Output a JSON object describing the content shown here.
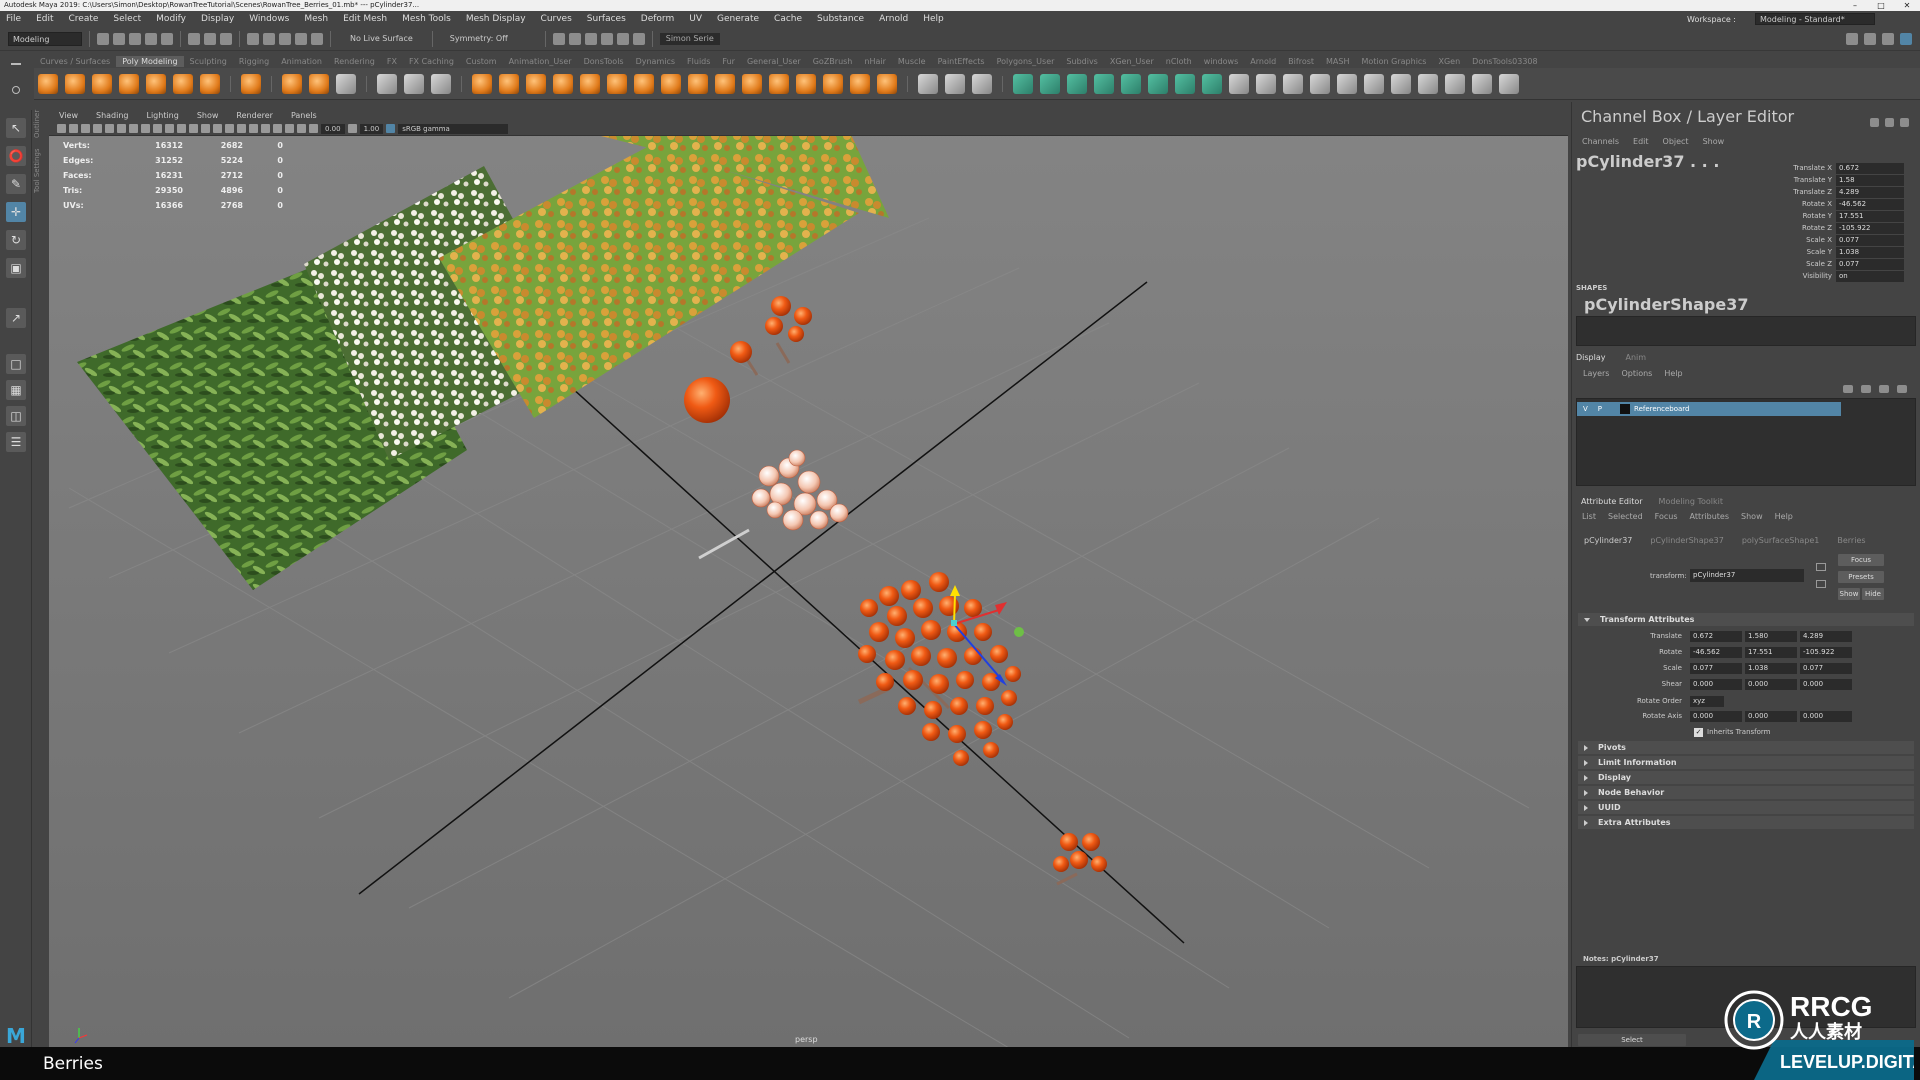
{
  "window": {
    "title": "Autodesk Maya 2019: C:\\Users\\Simon\\Desktop\\RowanTreeTutorial\\Scenes\\RowanTree_Berries_01.mb* --- pCylinder37...",
    "controls": [
      "–",
      "□",
      "✕"
    ]
  },
  "menu": [
    "File",
    "Edit",
    "Create",
    "Select",
    "Modify",
    "Display",
    "Windows",
    "Mesh",
    "Edit Mesh",
    "Mesh Tools",
    "Mesh Display",
    "Curves",
    "Surfaces",
    "Deform",
    "UV",
    "Generate",
    "Cache",
    "Substance",
    "Arnold",
    "Help"
  ],
  "workspace": {
    "label": "Workspace :",
    "value": "Modeling - Standard*"
  },
  "statusline": {
    "mode": "Modeling",
    "live": "No Live Surface",
    "symmetry": "Symmetry: Off",
    "user": "Simon Serie"
  },
  "shelf_tabs": [
    "Curves / Surfaces",
    "Poly Modeling",
    "Sculpting",
    "Rigging",
    "Animation",
    "Rendering",
    "FX",
    "FX Caching",
    "Custom",
    "Animation_User",
    "DonsTools",
    "Dynamics",
    "Fluids",
    "Fur",
    "General_User",
    "GoZBrush",
    "nHair",
    "Muscle",
    "PaintEffects",
    "Polygons_User",
    "Subdivs",
    "XGen_User",
    "nCloth",
    "windows",
    "Arnold",
    "Bifrost",
    "MASH",
    "Motion Graphics",
    "XGen",
    "DonsTools03308"
  ],
  "shelf_active": "Poly Modeling",
  "toolbox_tabs": [
    "Tool Settings",
    "Outliner"
  ],
  "viewport": {
    "menu": [
      "View",
      "Shading",
      "Lighting",
      "Show",
      "Renderer",
      "Panels"
    ],
    "exposure": "0.00",
    "gamma": "1.00",
    "colorspace": "sRGB gamma",
    "camera": "persp",
    "hud": [
      {
        "label": "Verts:",
        "a": "16312",
        "b": "2682",
        "c": "0"
      },
      {
        "label": "Edges:",
        "a": "31252",
        "b": "5224",
        "c": "0"
      },
      {
        "label": "Faces:",
        "a": "16231",
        "b": "2712",
        "c": "0"
      },
      {
        "label": "Tris:",
        "a": "29350",
        "b": "4896",
        "c": "0"
      },
      {
        "label": "UVs:",
        "a": "16366",
        "b": "2768",
        "c": "0"
      }
    ]
  },
  "channel_box": {
    "title": "Channel Box / Layer Editor",
    "menu": [
      "Channels",
      "Edit",
      "Object",
      "Show"
    ],
    "object": "pCylinder37 . . .",
    "channels": [
      {
        "label": "Translate X",
        "value": "0.672"
      },
      {
        "label": "Translate Y",
        "value": "1.58"
      },
      {
        "label": "Translate Z",
        "value": "4.289"
      },
      {
        "label": "Rotate X",
        "value": "-46.562"
      },
      {
        "label": "Rotate Y",
        "value": "17.551"
      },
      {
        "label": "Rotate Z",
        "value": "-105.922"
      },
      {
        "label": "Scale X",
        "value": "0.077"
      },
      {
        "label": "Scale Y",
        "value": "1.038"
      },
      {
        "label": "Scale Z",
        "value": "0.077"
      },
      {
        "label": "Visibility",
        "value": "on"
      }
    ],
    "shapes_label": "SHAPES",
    "shape": "pCylinderShape37"
  },
  "layer_editor": {
    "tabs": [
      "Display",
      "Anim"
    ],
    "menu": [
      "Layers",
      "Options",
      "Help"
    ],
    "layer": {
      "v": "V",
      "p": "P",
      "name": "Referenceboard"
    }
  },
  "attribute_editor": {
    "tabs": [
      "Attribute Editor",
      "Modeling Toolkit"
    ],
    "menu": [
      "List",
      "Selected",
      "Focus",
      "Attributes",
      "Show",
      "Help"
    ],
    "node_tabs": [
      "pCylinder37",
      "pCylinderShape37",
      "polySurfaceShape1",
      "Berries"
    ],
    "transform_label": "transform:",
    "transform_value": "pCylinder37",
    "buttons": {
      "focus": "Focus",
      "presets": "Presets",
      "show": "Show",
      "hide": "Hide"
    },
    "section_open": "Transform Attributes",
    "rows": [
      {
        "label": "Translate",
        "v": [
          "0.672",
          "1.580",
          "4.289"
        ]
      },
      {
        "label": "Rotate",
        "v": [
          "-46.562",
          "17.551",
          "-105.922"
        ]
      },
      {
        "label": "Scale",
        "v": [
          "0.077",
          "1.038",
          "0.077"
        ]
      },
      {
        "label": "Shear",
        "v": [
          "0.000",
          "0.000",
          "0.000"
        ]
      }
    ],
    "rotate_order_label": "Rotate Order",
    "rotate_order": "xyz",
    "rotate_axis_label": "Rotate Axis",
    "rotate_axis": [
      "0.000",
      "0.000",
      "0.000"
    ],
    "inherits": "Inherits Transform",
    "sections": [
      "Pivots",
      "Limit Information",
      "Display",
      "Node Behavior",
      "UUID",
      "Extra Attributes"
    ],
    "notes": "Notes: pCylinder37",
    "select_btn": "Select"
  },
  "caption": "Berries",
  "watermark": {
    "line1": "RRCG",
    "line2": "人人素材",
    "line3": "LEVELUP.DIGITAL"
  }
}
